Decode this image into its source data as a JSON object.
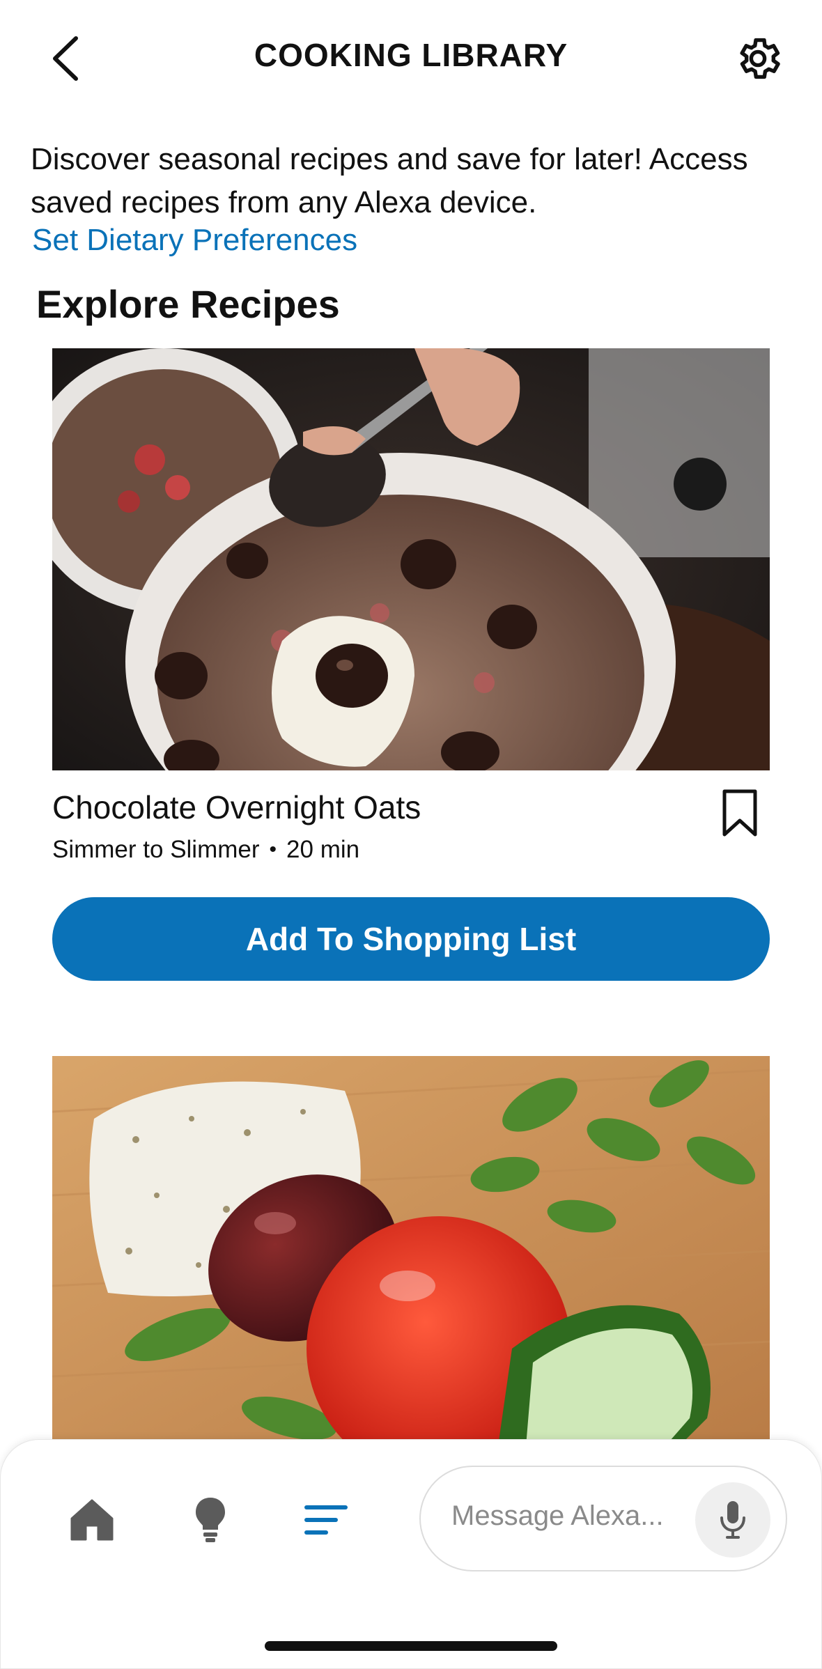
{
  "header": {
    "title": "COOKING LIBRARY",
    "back_icon": "chevron-left-icon",
    "settings_icon": "gear-icon"
  },
  "intro": {
    "text": "Discover seasonal recipes and save for later! Access saved recipes from any Alexa device.",
    "link": "Set Dietary Preferences"
  },
  "section": {
    "title": "Explore Recipes"
  },
  "recipes": [
    {
      "name": "Chocolate Overnight Oats",
      "source": "Simmer to Slimmer",
      "separator": "•",
      "time": "20 min",
      "button": "Add To Shopping List",
      "bookmark_icon": "bookmark-icon"
    },
    {
      "image": "feta-olive-tomato-cucumber-photo"
    }
  ],
  "bottom_nav": {
    "items": [
      "home-icon",
      "lightbulb-icon",
      "lists-icon"
    ],
    "message_placeholder": "Message Alexa...",
    "mic_icon": "microphone-icon"
  },
  "colors": {
    "accent": "#0a72b8",
    "text": "#111111",
    "placeholder": "#8a8a8a"
  }
}
